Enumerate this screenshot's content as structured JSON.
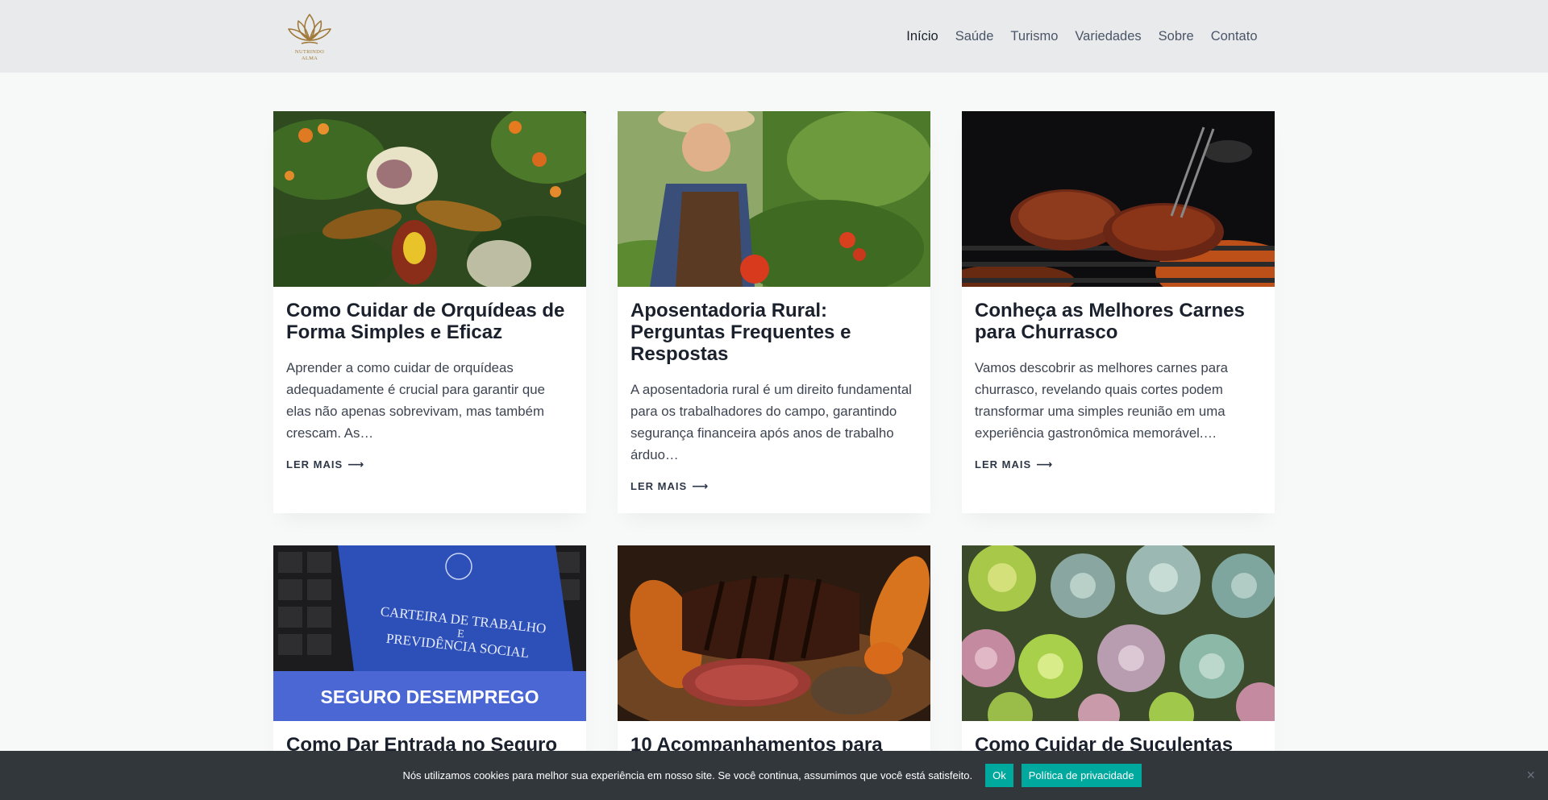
{
  "header": {
    "logo_text_line1": "NUTRINDO",
    "logo_text_line2": "ALMA",
    "nav": [
      "Início",
      "Saúde",
      "Turismo",
      "Variedades",
      "Sobre",
      "Contato"
    ]
  },
  "posts": [
    {
      "title": "Como Cuidar de Orquídeas de Forma Simples e Eficaz",
      "excerpt": "Aprender a como cuidar de orquídeas adequadamente é crucial para garantir que elas não apenas sobrevivam, mas também crescam. As…",
      "more": "LER MAIS",
      "image": "orchid-photo"
    },
    {
      "title": "Aposentadoria Rural: Perguntas Frequentes e Respostas",
      "excerpt": "A aposentadoria rural é um direito fundamental para os trabalhadores do campo, garantindo segurança financeira após anos de trabalho árduo…",
      "more": "LER MAIS",
      "image": "farmer-photo"
    },
    {
      "title": "Conheça as Melhores Carnes para Churrasco",
      "excerpt": "Vamos descobrir as melhores carnes para churrasco, revelando quais cortes podem transformar uma simples reunião em uma experiência gastronômica memorável.…",
      "more": "LER MAIS",
      "image": "grill-photo"
    },
    {
      "title": "Como Dar Entrada no Seguro",
      "image": "work-card-photo",
      "image_text1": "CARTEIRA DE TRABALHO",
      "image_text2": "E",
      "image_text3": "PREVIDÊNCIA SOCIAL",
      "image_banner": "SEGURO DESEMPREGO"
    },
    {
      "title": "10 Acompanhamentos para",
      "image": "steak-photo"
    },
    {
      "title": "Como Cuidar de Suculentas",
      "image": "succulents-photo"
    }
  ],
  "cookie": {
    "text": "Nós utilizamos cookies para melhor sua experiência em nosso site. Se você continua, assumimos que você está satisfeito.",
    "ok": "Ok",
    "policy": "Política de privacidade",
    "close": "×"
  },
  "colors": {
    "header_bg": "#e9eaeb",
    "page_bg": "#f7f8f8",
    "cookie_bg": "#32373c",
    "cookie_button": "#00a99d",
    "logo_gold": "#a07a3a"
  }
}
